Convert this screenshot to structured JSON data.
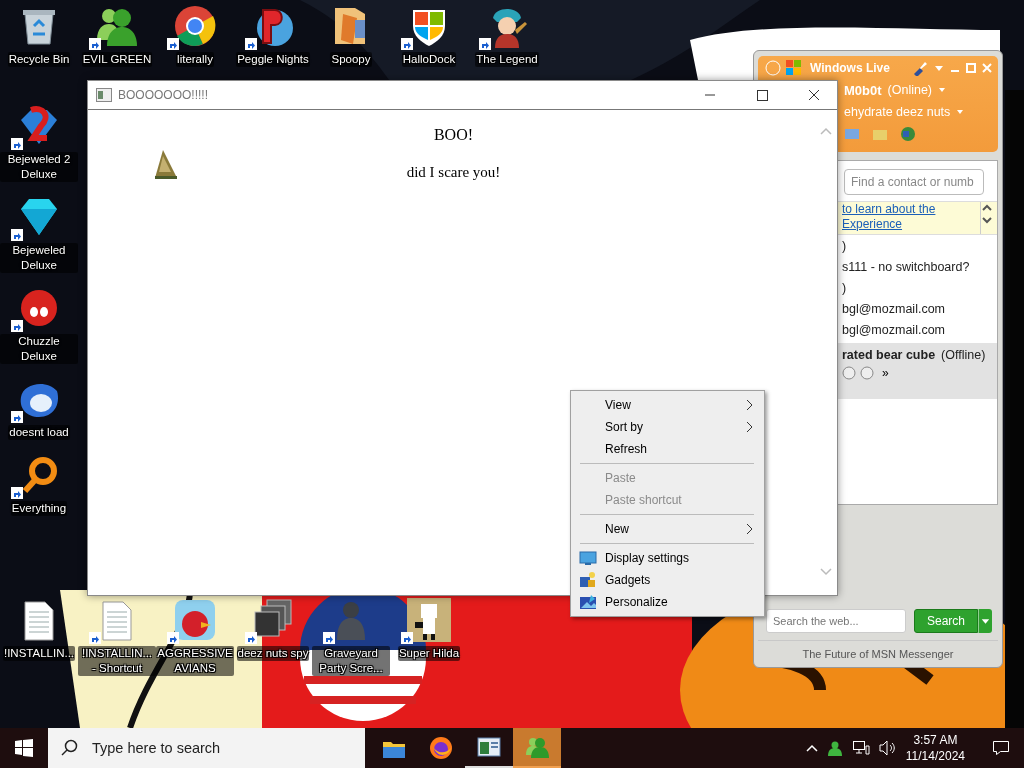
{
  "desktop": {
    "top_row": [
      {
        "label": "Recycle Bin",
        "shortcut": false
      },
      {
        "label": "EVIL GREEN",
        "shortcut": true
      },
      {
        "label": "literally",
        "shortcut": true
      },
      {
        "label": "Peggle Nights",
        "shortcut": true
      },
      {
        "label": "Spoopy",
        "shortcut": false
      },
      {
        "label": "HalloDock",
        "shortcut": true
      },
      {
        "label": "The Legend",
        "shortcut": true
      }
    ],
    "left_column": [
      {
        "label": "Bejeweled 2 Deluxe",
        "shortcut": true
      },
      {
        "label": "Bejeweled Deluxe",
        "shortcut": true
      },
      {
        "label": "Chuzzle Deluxe",
        "shortcut": true
      },
      {
        "label": "doesnt load",
        "shortcut": true
      },
      {
        "label": "Everything",
        "shortcut": true
      }
    ],
    "bottom_row": [
      {
        "label": "!INSTALLIN...",
        "shortcut": false
      },
      {
        "label": "!INSTALLIN... - Shortcut",
        "shortcut": true
      },
      {
        "label": "AGGRESSIVE AVIANS",
        "shortcut": true
      },
      {
        "label": "deez nuts spy",
        "shortcut": true
      },
      {
        "label": "Graveyard Party Scre...",
        "shortcut": true
      },
      {
        "label": "Super Hilda",
        "shortcut": true
      }
    ]
  },
  "window": {
    "title": "BOOOOOOO!!!!!",
    "heading": "BOO!",
    "message": "did I scare you!"
  },
  "messenger": {
    "brand": "Windows Live",
    "user": "M0b0t",
    "status": "(Online)",
    "personal_message": "ehydrate deez nuts",
    "contact_search": {
      "placeholder": "Find a contact or numb"
    },
    "notice": [
      "to learn about the",
      "Experience"
    ],
    "contacts": [
      {
        "name": ")",
        "selected": false
      },
      {
        "name": "s111 - no switchboard?",
        "selected": false
      },
      {
        "name": ")",
        "selected": false
      },
      {
        "name": "bgl@mozmail.com",
        "selected": false
      },
      {
        "name": "bgl@mozmail.com",
        "selected": false
      },
      {
        "name": "rated bear cube",
        "status": "(Offline)",
        "more": "»",
        "selected": true
      }
    ],
    "web_search": {
      "placeholder": "Search the web...",
      "button": "Search"
    },
    "footer": "The Future of MSN Messenger"
  },
  "context_menu": [
    {
      "kind": "item",
      "label": "View",
      "submenu": true,
      "disabled": false
    },
    {
      "kind": "item",
      "label": "Sort by",
      "submenu": true,
      "disabled": false
    },
    {
      "kind": "item",
      "label": "Refresh",
      "submenu": false,
      "disabled": false
    },
    {
      "kind": "separator"
    },
    {
      "kind": "item",
      "label": "Paste",
      "submenu": false,
      "disabled": true
    },
    {
      "kind": "item",
      "label": "Paste shortcut",
      "submenu": false,
      "disabled": true
    },
    {
      "kind": "separator"
    },
    {
      "kind": "item",
      "label": "New",
      "submenu": true,
      "disabled": false
    },
    {
      "kind": "separator"
    },
    {
      "kind": "item",
      "label": "Display settings",
      "submenu": false,
      "disabled": false
    },
    {
      "kind": "item",
      "label": "Gadgets",
      "submenu": false,
      "disabled": false
    },
    {
      "kind": "item",
      "label": "Personalize",
      "submenu": false,
      "disabled": false
    }
  ],
  "taskbar": {
    "search_placeholder": "Type here to search",
    "apps": [
      {
        "running": false,
        "active": false
      },
      {
        "running": false,
        "active": false
      },
      {
        "running": true,
        "active": false
      },
      {
        "running": true,
        "active": true
      }
    ],
    "time": "3:57 AM",
    "date": "11/14/2024"
  }
}
